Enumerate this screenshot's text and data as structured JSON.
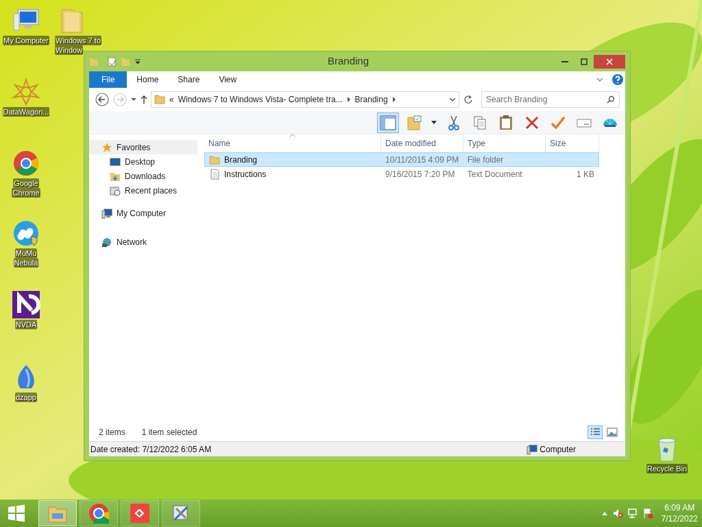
{
  "desktop": {
    "icons": [
      {
        "lines": [
          "My Computer"
        ]
      },
      {
        "lines": [
          "Windows 7 to",
          "Window"
        ]
      },
      {
        "lines": [
          "DataWagon..."
        ]
      },
      {
        "lines": [
          "Google",
          "Chrome"
        ]
      },
      {
        "lines": [
          "MuMu",
          "Nebula"
        ]
      },
      {
        "lines": [
          "NVDA"
        ]
      },
      {
        "lines": [
          "dzapp"
        ]
      },
      {
        "lines": [
          "Recycle Bin"
        ]
      }
    ]
  },
  "window": {
    "title": "Branding",
    "ribbon_tabs": [
      {
        "label": "File",
        "kind": "file",
        "selected": false
      },
      {
        "label": "Home",
        "kind": "tab",
        "selected": false
      },
      {
        "label": "Share",
        "kind": "tab",
        "selected": false
      },
      {
        "label": "View",
        "kind": "tab",
        "selected": false
      }
    ],
    "address": {
      "overflow": "«",
      "crumbs": [
        "Windows 7 to Windows Vista- Complete tra...",
        "Branding"
      ]
    },
    "search": {
      "placeholder": "Search Branding"
    },
    "toolbar": {
      "layout_pressed": true
    },
    "nav": [
      {
        "label": "Favorites",
        "kind": "favorites",
        "selected": true,
        "children": [
          {
            "label": "Desktop",
            "kind": "desktop",
            "selected": false
          },
          {
            "label": "Downloads",
            "kind": "downloads",
            "selected": false
          },
          {
            "label": "Recent places",
            "kind": "recent",
            "selected": false
          }
        ]
      },
      {
        "label": "My Computer",
        "kind": "computer",
        "selected": false
      },
      {
        "label": "Network",
        "kind": "network",
        "selected": false
      }
    ],
    "columns": [
      "Name",
      "Date modified",
      "Type",
      "Size"
    ],
    "rows": [
      {
        "name": "Branding",
        "date": "10/11/2015 4:09 PM",
        "type": "File folder",
        "size": "",
        "kind": "folder",
        "selected": true
      },
      {
        "name": "Instructions",
        "date": "9/16/2015 7:20 PM",
        "type": "Text Document",
        "size": "1 KB",
        "kind": "text",
        "selected": false
      }
    ],
    "item_count": "2 items",
    "selection_count": "1 item selected",
    "views": [
      {
        "kind": "details",
        "selected": true
      },
      {
        "kind": "large",
        "selected": false
      }
    ],
    "status_bar": {
      "info": "Date created: 7/12/2022 6:05 AM",
      "location": "Computer"
    }
  },
  "taskbar": {
    "buttons": [
      {
        "selected": true
      },
      {
        "selected": false
      },
      {
        "selected": false
      },
      {
        "selected": false
      }
    ],
    "time": "6:09 AM",
    "date": "7/12/2022"
  }
}
